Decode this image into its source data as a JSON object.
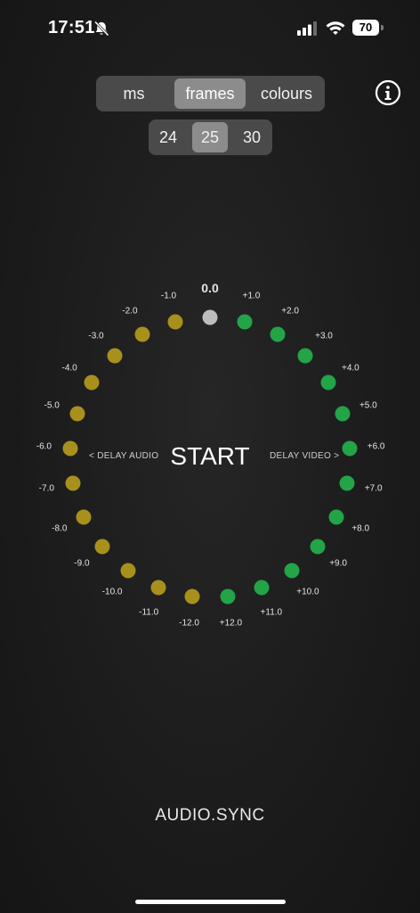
{
  "status_bar": {
    "time": "17:51",
    "battery": "70"
  },
  "mode_control": {
    "options": [
      "ms",
      "frames",
      "colours"
    ],
    "selected": "frames"
  },
  "fps_control": {
    "options": [
      "24",
      "25",
      "30"
    ],
    "selected": "25"
  },
  "dial": {
    "center_value": "0.0",
    "audio_labels": [
      "-1.0",
      "-2.0",
      "-3.0",
      "-4.0",
      "-5.0",
      "-6.0",
      "-7.0",
      "-8.0",
      "-9.0",
      "-10.0",
      "-11.0",
      "-12.0"
    ],
    "video_labels": [
      "+1.0",
      "+2.0",
      "+3.0",
      "+4.0",
      "+5.0",
      "+6.0",
      "+7.0",
      "+8.0",
      "+9.0",
      "+10.0",
      "+11.0",
      "+12.0"
    ],
    "delay_audio_label": "< DELAY AUDIO",
    "delay_video_label": "DELAY VIDEO >",
    "start_label": "START"
  },
  "colors": {
    "neutral_dot": "#bdbdbd",
    "audio_dot": "#a8901c",
    "video_dot": "#22a447"
  },
  "footer": {
    "brand": "AUDIO.SYNC"
  }
}
